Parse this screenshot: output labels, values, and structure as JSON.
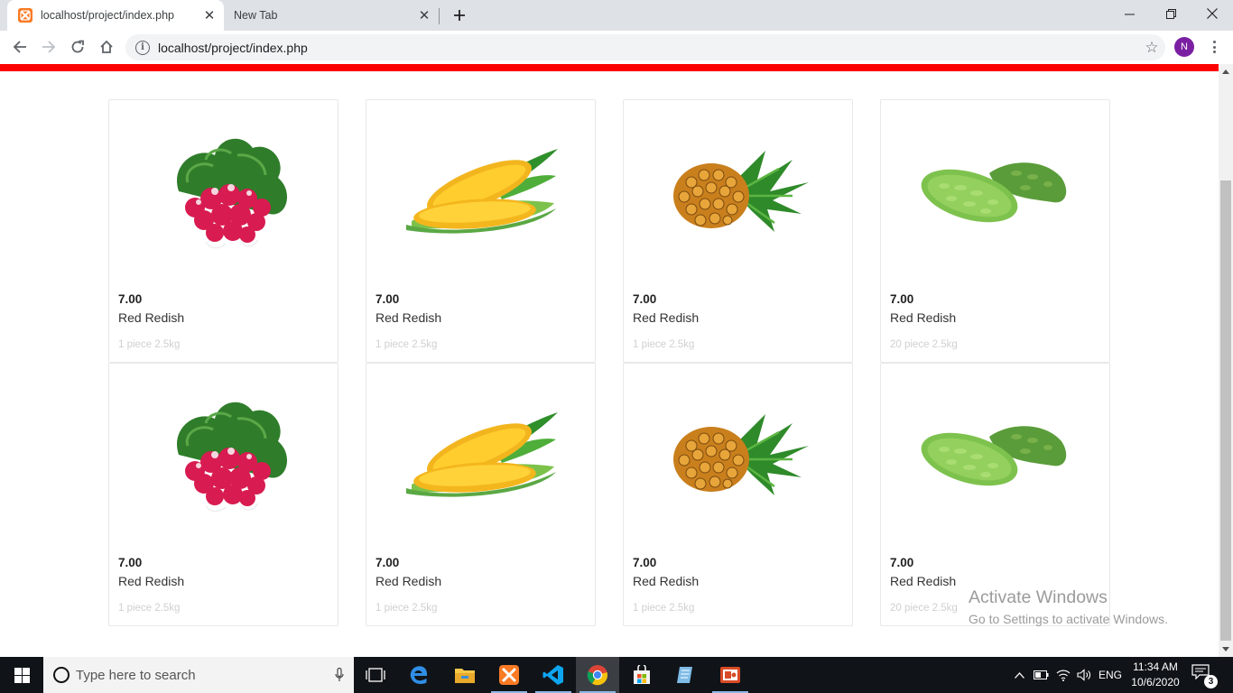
{
  "browser": {
    "tabs": [
      {
        "title": "localhost/project/index.php",
        "active": true
      },
      {
        "title": "New Tab",
        "active": false
      }
    ],
    "url": "localhost/project/index.php",
    "profile_initial": "N"
  },
  "page": {
    "accent_color": "#fe0000",
    "products": [
      {
        "price": "7.00",
        "name": "Red Redish",
        "meta": "1 piece 2.5kg",
        "image": "radish"
      },
      {
        "price": "7.00",
        "name": "Red Redish",
        "meta": "1 piece 2.5kg",
        "image": "corn"
      },
      {
        "price": "7.00",
        "name": "Red Redish",
        "meta": "1 piece 2.5kg",
        "image": "pineapple"
      },
      {
        "price": "7.00",
        "name": "Red Redish",
        "meta": "20 piece 2.5kg",
        "image": "bitter-gourd"
      },
      {
        "price": "7.00",
        "name": "Red Redish",
        "meta": "1 piece 2.5kg",
        "image": "radish"
      },
      {
        "price": "7.00",
        "name": "Red Redish",
        "meta": "1 piece 2.5kg",
        "image": "corn"
      },
      {
        "price": "7.00",
        "name": "Red Redish",
        "meta": "1 piece 2.5kg",
        "image": "pineapple"
      },
      {
        "price": "7.00",
        "name": "Red Redish",
        "meta": "20 piece 2.5kg",
        "image": "bitter-gourd"
      }
    ]
  },
  "watermark": {
    "line1": "Activate Windows",
    "line2": "Go to Settings to activate Windows."
  },
  "taskbar": {
    "search_placeholder": "Type here to search",
    "language": "ENG",
    "time": "11:34 AM",
    "date": "10/6/2020",
    "notification_count": "3"
  }
}
